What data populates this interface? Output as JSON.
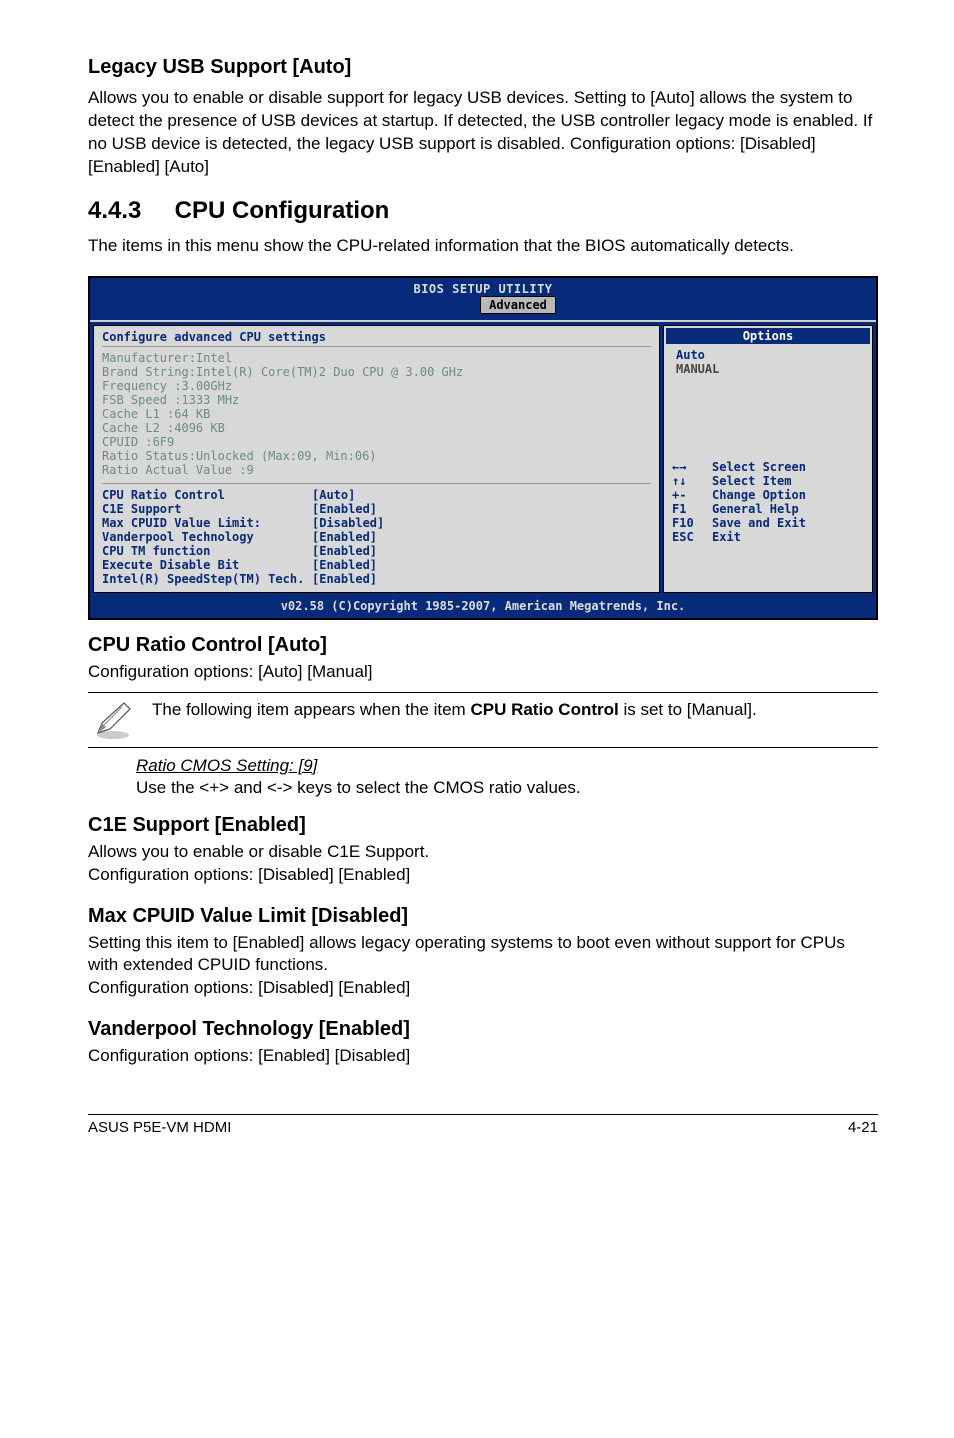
{
  "legacy": {
    "title": "Legacy USB Support [Auto]",
    "desc": "Allows you to enable or disable support for legacy USB devices. Setting to [Auto] allows the system to detect the presence of USB devices at startup. If detected, the USB controller legacy mode is enabled. If no USB device is detected, the legacy USB support is disabled. Configuration options: [Disabled] [Enabled] [Auto]"
  },
  "section": {
    "num": "4.4.3",
    "title": "CPU Configuration"
  },
  "section_intro": "The items in this menu show the CPU-related information that the BIOS automatically detects.",
  "bios": {
    "title": "BIOS SETUP UTILITY",
    "tab": "Advanced",
    "subheader": "Configure advanced CPU settings",
    "info": [
      "Manufacturer:Intel",
      "Brand String:Intel(R) Core(TM)2 Duo CPU @ 3.00 GHz",
      "Frequency   :3.00GHz",
      "FSB Speed   :1333 MHz",
      "Cache L1    :64 KB",
      "Cache L2    :4096 KB",
      "CPUID       :6F9",
      "Ratio Status:Unlocked (Max:09, Min:06)",
      "Ratio Actual Value  :9"
    ],
    "settings": [
      {
        "label": "CPU Ratio Control",
        "value": "[Auto]"
      },
      {
        "label": "C1E Support",
        "value": "[Enabled]"
      },
      {
        "label": "Max CPUID Value Limit:",
        "value": "[Disabled]"
      },
      {
        "label": "Vanderpool Technology",
        "value": "[Enabled]"
      },
      {
        "label": "CPU TM function",
        "value": "[Enabled]"
      },
      {
        "label": "Execute Disable Bit",
        "value": "[Enabled]"
      },
      {
        "label": "Intel(R) SpeedStep(TM) Tech.",
        "value": "[Enabled]"
      }
    ],
    "options_header": "Options",
    "options": [
      {
        "text": "Auto",
        "cls": "opt-val"
      },
      {
        "text": "MANUAL",
        "cls": "opt-hint"
      }
    ],
    "help": [
      {
        "key": "←→",
        "txt": "Select Screen"
      },
      {
        "key": "↑↓",
        "txt": "Select Item"
      },
      {
        "key": "+-",
        "txt": "Change Option"
      },
      {
        "key": "F1",
        "txt": "General Help"
      },
      {
        "key": "F10",
        "txt": "Save and Exit"
      },
      {
        "key": "ESC",
        "txt": "Exit"
      }
    ],
    "footer": "v02.58 (C)Copyright 1985-2007, American Megatrends, Inc."
  },
  "cpu_ratio": {
    "title": "CPU Ratio Control [Auto]",
    "desc": "Configuration options: [Auto] [Manual]"
  },
  "note": {
    "pre": "The following item appears when the item ",
    "bold": "CPU Ratio Control",
    "post": " is set to [Manual]."
  },
  "ratio_setting": {
    "link": "Ratio CMOS Setting: [9]",
    "desc": "Use the <+> and <-> keys to select the CMOS ratio values."
  },
  "c1e": {
    "title": "C1E Support [Enabled]",
    "desc1": "Allows you to enable or disable C1E Support.",
    "desc2": "Configuration options: [Disabled] [Enabled]"
  },
  "maxcpuid": {
    "title": "Max CPUID Value Limit [Disabled]",
    "desc1": "Setting this item to [Enabled] allows legacy operating systems to boot even without support for CPUs with extended CPUID functions.",
    "desc2": "Configuration options: [Disabled] [Enabled]"
  },
  "vanderpool": {
    "title": "Vanderpool Technology [Enabled]",
    "desc": "Configuration options: [Enabled] [Disabled]"
  },
  "footer": {
    "left": "ASUS P5E-VM HDMI",
    "right": "4-21"
  }
}
